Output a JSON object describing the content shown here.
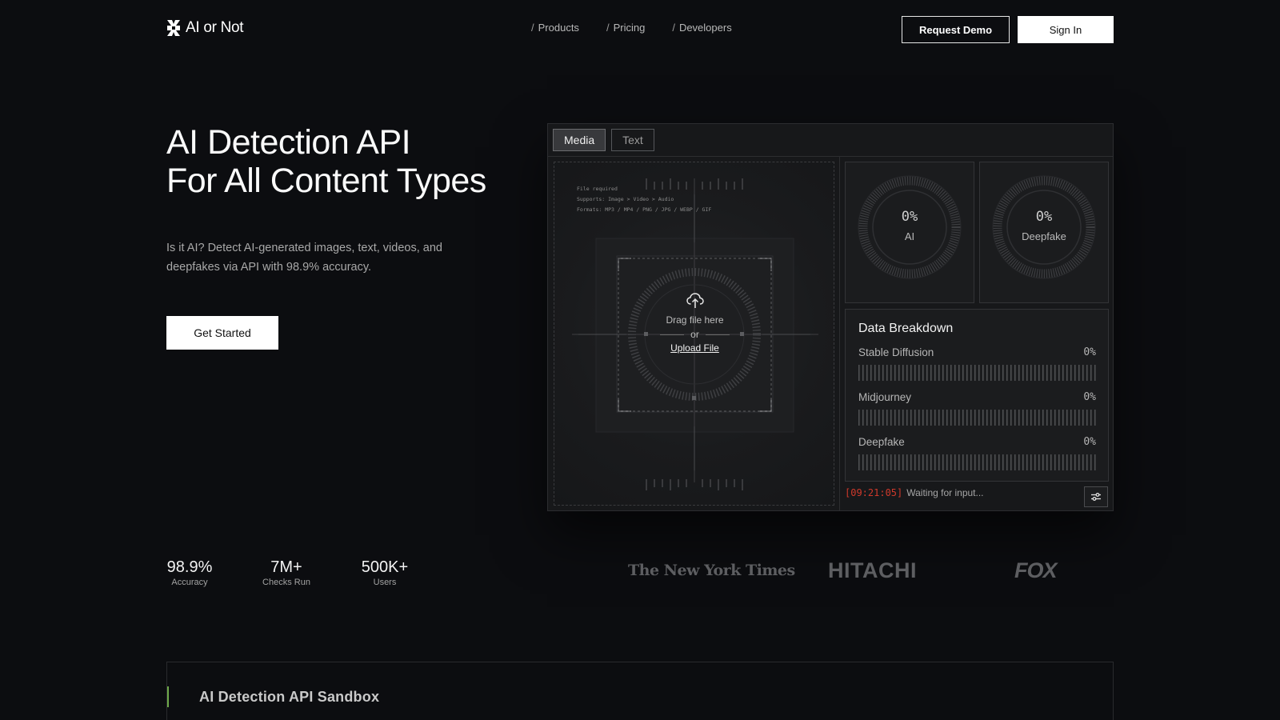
{
  "nav": {
    "logo_text": "AI or Not",
    "links": [
      {
        "slash": "/",
        "label": "Products"
      },
      {
        "slash": "/",
        "label": "Pricing"
      },
      {
        "slash": "/",
        "label": "Developers"
      }
    ],
    "request_demo": "Request Demo",
    "sign_in": "Sign In"
  },
  "hero": {
    "title_line1": "AI Detection API",
    "title_line2": "For All Content Types",
    "subtitle": "Is it AI? Detect AI-generated images, text, videos, and deepfakes via API with 98.9% accuracy.",
    "cta": "Get Started"
  },
  "demo": {
    "tabs": [
      {
        "label": "Media",
        "active": true
      },
      {
        "label": "Text",
        "active": false
      }
    ],
    "dropzone": {
      "meta_line1": "File required",
      "meta_line2": "Supports: Image > Video > Audio",
      "meta_line3": "Formats: MP3 / MP4 / PNG / JPG / WEBP / GIF",
      "drag_text": "Drag file here",
      "or_text": "or",
      "upload_link": "Upload File",
      "icon": "cloud-upload-icon"
    },
    "gauges": [
      {
        "value": "0%",
        "label": "AI"
      },
      {
        "value": "0%",
        "label": "Deepfake"
      }
    ],
    "breakdown": {
      "title": "Data Breakdown",
      "rows": [
        {
          "name": "Stable Diffusion",
          "value": "0%"
        },
        {
          "name": "Midjourney",
          "value": "0%"
        },
        {
          "name": "Deepfake",
          "value": "0%"
        }
      ]
    },
    "status": {
      "time": "[09:21:05]",
      "message": "Waiting for input..."
    },
    "settings_icon": "sliders-icon"
  },
  "stats": [
    {
      "value": "98.9%",
      "label": "Accuracy"
    },
    {
      "value": "7M+",
      "label": "Checks Run"
    },
    {
      "value": "500K+",
      "label": "Users"
    }
  ],
  "partner_logos": [
    "The New York Times",
    "HITACHI",
    "FOX"
  ],
  "sandbox": {
    "title": "AI Detection API Sandbox"
  },
  "colors": {
    "background": "#0c0d10",
    "accent_green": "#6ea84a",
    "status_red": "#d0392b"
  }
}
